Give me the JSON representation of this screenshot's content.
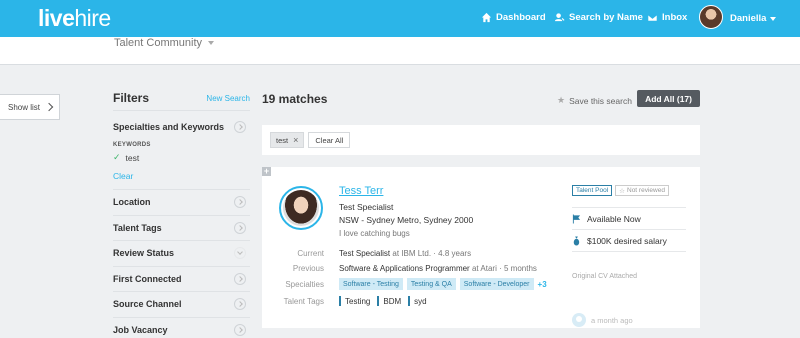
{
  "app": {
    "logo": {
      "bold": "live",
      "thin": "hire"
    },
    "nav": [
      {
        "label": "Dashboard",
        "icon": "home-icon"
      },
      {
        "label": "Search by Name",
        "icon": "user-search-icon"
      },
      {
        "label": "Inbox",
        "icon": "mail-icon"
      }
    ],
    "user": {
      "name": "Daniella"
    },
    "brand_color": "#2bb5e8"
  },
  "subheader": {
    "title": "Talent Community"
  },
  "show_list": {
    "label": "Show list"
  },
  "filters": {
    "title": "Filters",
    "new_search": "New Search",
    "specialties": {
      "label": "Specialties and Keywords",
      "keywords_heading": "KEYWORDS",
      "keywords": [
        "test"
      ],
      "clear": "Clear"
    },
    "sections": [
      {
        "label": "Location"
      },
      {
        "label": "Talent Tags"
      },
      {
        "label": "Review Status"
      },
      {
        "label": "First Connected"
      },
      {
        "label": "Source Channel"
      },
      {
        "label": "Job Vacancy"
      }
    ]
  },
  "results": {
    "count_label": "19 matches",
    "save_search": "Save this search",
    "add_all": "Add All (17)",
    "search_tags": [
      "test"
    ],
    "clear_all": "Clear All"
  },
  "candidate": {
    "name": "Tess Terr",
    "title": "Test Specialist",
    "location": "NSW - Sydney Metro, Sydney 2000",
    "tagline": "I love catching bugs",
    "labels": {
      "current": "Current",
      "previous": "Previous",
      "specialties": "Specialties",
      "talent_tags": "Talent Tags"
    },
    "current": {
      "role": "Test Specialist",
      "company": "at IBM Ltd.",
      "duration": "· 4.8 years"
    },
    "previous": {
      "role": "Software & Applications Programmer",
      "company": "at Atari",
      "duration": "· 5 months"
    },
    "specialties": [
      "Software - Testing",
      "Testing & QA",
      "Software - Developer"
    ],
    "specialties_more": "+3",
    "talent_tags": [
      "Testing",
      "BDM",
      "syd"
    ],
    "pool_badge": "Talent Pool",
    "review_badge": "Not reviewed",
    "availability": "Available Now",
    "salary": "$100K desired salary",
    "cv_note": "Original CV Attached",
    "activity": "a month ago"
  }
}
